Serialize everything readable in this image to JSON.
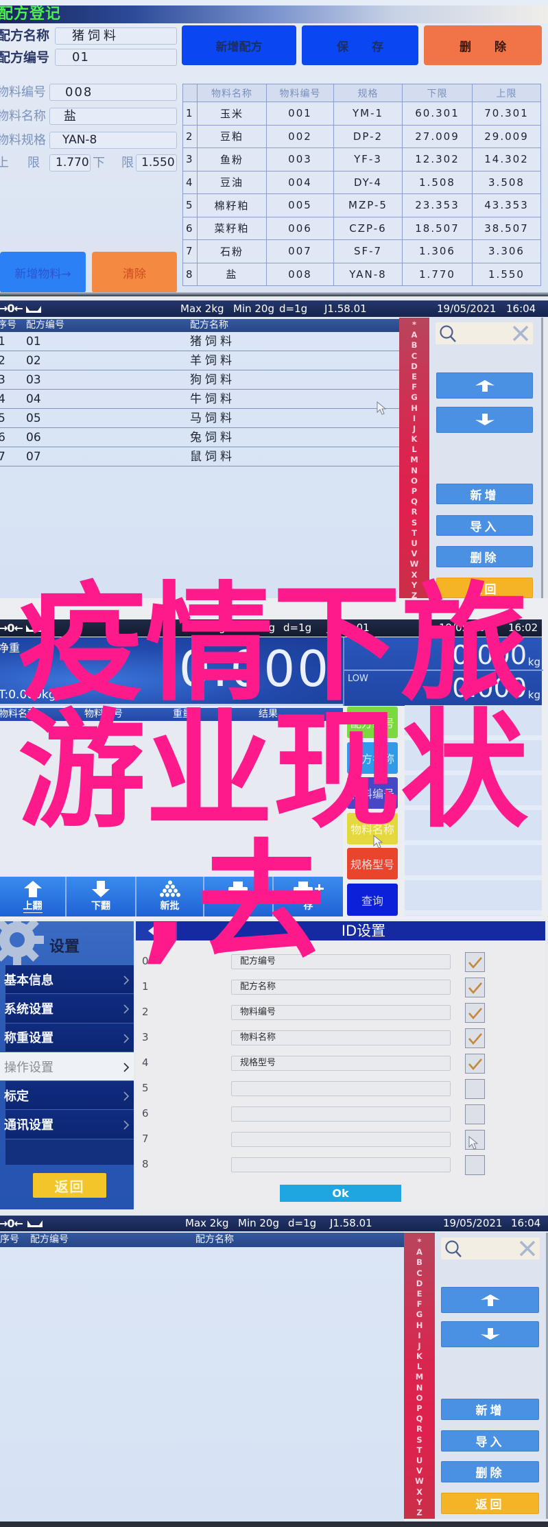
{
  "overlay": {
    "lines": [
      "疫情下旅",
      "游业现状",
      ",去"
    ],
    "color": "#ff1a8c"
  },
  "recipe_register": {
    "title": "配方登记",
    "recipe_name": {
      "label": "配方名称",
      "value": "猪饲料"
    },
    "recipe_id": {
      "label": "配方编号",
      "value": "01"
    },
    "buttons": {
      "new_recipe": "新增配方",
      "save": "保　　存",
      "delete": "删　　除"
    },
    "material_id": {
      "label": "物料编号",
      "value": "008"
    },
    "material_name": {
      "label": "物料名称",
      "value": "盐"
    },
    "material_spec": {
      "label": "物料规格",
      "value": "YAN-8"
    },
    "upper_limit": {
      "label_left": "上",
      "label_right": "限",
      "value": "1.770"
    },
    "lower_limit": {
      "label_left": "下",
      "label_right": "限",
      "value": "1.550"
    },
    "add_material_button": "新增物料→",
    "clear_button": "清除",
    "table": {
      "headers": [
        "",
        "物料名称",
        "物料编号",
        "规格",
        "下限",
        "上限"
      ],
      "rows": [
        [
          "1",
          "玉米",
          "001",
          "YM-1",
          "60.301",
          "70.301"
        ],
        [
          "2",
          "豆粕",
          "002",
          "DP-2",
          "27.009",
          "29.009"
        ],
        [
          "3",
          "鱼粉",
          "003",
          "YF-3",
          "12.302",
          "14.302"
        ],
        [
          "4",
          "豆油",
          "004",
          "DY-4",
          "1.508",
          "3.508"
        ],
        [
          "5",
          "棉籽粕",
          "005",
          "MZP-5",
          "23.353",
          "43.353"
        ],
        [
          "6",
          "菜籽粕",
          "006",
          "CZP-6",
          "18.507",
          "38.507"
        ],
        [
          "7",
          "石粉",
          "007",
          "SF-7",
          "1.306",
          "3.306"
        ],
        [
          "8",
          "盐",
          "008",
          "YAN-8",
          "1.770",
          "1.550"
        ]
      ]
    },
    "colors": {
      "title_text": "#4cf04c",
      "primary_button": "#0a47f2",
      "danger_button": "#f07448",
      "add_button": "#2c80f6",
      "clear_button": "#f48a42"
    }
  },
  "recipe_list": {
    "status_bar": {
      "zero_glyph": "→0←",
      "max": "Max 2kg",
      "min": "Min 20g",
      "division": "d=1g",
      "version": "J1.58.01",
      "date": "19/05/2021",
      "time": "16:04"
    },
    "headers": {
      "index": "序号",
      "recipe_id": "配方编号",
      "recipe_name": "配方名称"
    },
    "rows": [
      [
        "1",
        "01",
        "猪饲料"
      ],
      [
        "2",
        "02",
        "羊饲料"
      ],
      [
        "3",
        "03",
        "狗饲料"
      ],
      [
        "4",
        "04",
        "牛饲料"
      ],
      [
        "5",
        "05",
        "马饲料"
      ],
      [
        "6",
        "06",
        "兔饲料"
      ],
      [
        "7",
        "07",
        "鼠饲料"
      ]
    ],
    "alphabet": [
      "*",
      "A",
      "B",
      "C",
      "D",
      "E",
      "F",
      "G",
      "H",
      "I",
      "J",
      "K",
      "L",
      "M",
      "N",
      "O",
      "P",
      "Q",
      "R",
      "S",
      "T",
      "U",
      "V",
      "W",
      "X",
      "Y",
      "Z"
    ],
    "search_value": "",
    "buttons": {
      "add": "新增",
      "import": "导入",
      "delete": "删除",
      "back": "返回"
    },
    "colors": {
      "alphabet_bar": "#e0204e",
      "action_button": "#4b91e3",
      "back_button": "#f5b426"
    }
  },
  "weighing": {
    "status_bar": {
      "zero_glyph": "→0←",
      "max": "Max 2kg",
      "min": "Min 20g",
      "division": "d=1g",
      "version": "J1.58.01",
      "date": "19/05/2021",
      "time": "16:02"
    },
    "net_label": "净重",
    "net_weight": "0.000",
    "tare": "T:0.000kg",
    "high_limit": {
      "value": "0.000",
      "unit": "kg"
    },
    "low_limit": {
      "label": "LOW",
      "value": "0.000",
      "unit": "kg"
    },
    "headers": {
      "material_name": "物料名称",
      "material_id": "物料编号",
      "weight": "重量",
      "result": "结果"
    },
    "side_buttons": [
      {
        "label": "配方编号",
        "color": "#7bd83e"
      },
      {
        "label": "配方名称",
        "color": "#2f9be8"
      },
      {
        "label": "物料编号",
        "color": "#4547c4"
      },
      {
        "label": "物料名称",
        "color": "#e3d83c"
      },
      {
        "label": "规格型号",
        "color": "#e9452d"
      },
      {
        "label": "查询",
        "color": "#0b20d8"
      }
    ],
    "toolbar": [
      {
        "label": "上翻",
        "icon": "page-up"
      },
      {
        "label": "下翻",
        "icon": "page-down"
      },
      {
        "label": "新批",
        "icon": "new-batch"
      },
      {
        "label": "",
        "icon": "print"
      },
      {
        "label": "存",
        "icon": "print-add"
      }
    ]
  },
  "settings": {
    "title": "设置",
    "menu": [
      {
        "label": "基本信息",
        "active": false
      },
      {
        "label": "系统设置",
        "active": false
      },
      {
        "label": "称重设置",
        "active": false
      },
      {
        "label": "操作设置",
        "active": true
      },
      {
        "label": "标定",
        "active": false
      },
      {
        "label": "通讯设置",
        "active": false
      }
    ],
    "back_button": "返回",
    "panel_title": "ID设置",
    "id_rows": [
      {
        "index": "0",
        "label": "配方编号",
        "checked": true
      },
      {
        "index": "1",
        "label": "配方名称",
        "checked": true
      },
      {
        "index": "2",
        "label": "物料编号",
        "checked": true
      },
      {
        "index": "3",
        "label": "物料名称",
        "checked": true
      },
      {
        "index": "4",
        "label": "规格型号",
        "checked": true
      },
      {
        "index": "5",
        "label": "",
        "checked": false
      },
      {
        "index": "6",
        "label": "",
        "checked": false
      },
      {
        "index": "7",
        "label": "",
        "checked": false
      },
      {
        "index": "8",
        "label": "",
        "checked": false
      }
    ],
    "ok_button": "Ok"
  },
  "recipe_list_empty": {
    "status_bar": {
      "zero_glyph": "→0←",
      "max": "Max 2kg",
      "min": "Min 20g",
      "division": "d=1g",
      "version": "J1.58.01",
      "date": "19/05/2021",
      "time": "16:04"
    },
    "headers": {
      "index": "序号",
      "recipe_id": "配方编号",
      "recipe_name": "配方名称"
    },
    "rows": [],
    "alphabet": [
      "*",
      "A",
      "B",
      "C",
      "D",
      "E",
      "F",
      "G",
      "H",
      "I",
      "J",
      "K",
      "L",
      "M",
      "N",
      "O",
      "P",
      "Q",
      "R",
      "S",
      "T",
      "U",
      "V",
      "W",
      "X",
      "Y",
      "Z"
    ],
    "search_value": "",
    "buttons": {
      "add": "新增",
      "import": "导入",
      "delete": "删除",
      "back": "返回"
    }
  }
}
